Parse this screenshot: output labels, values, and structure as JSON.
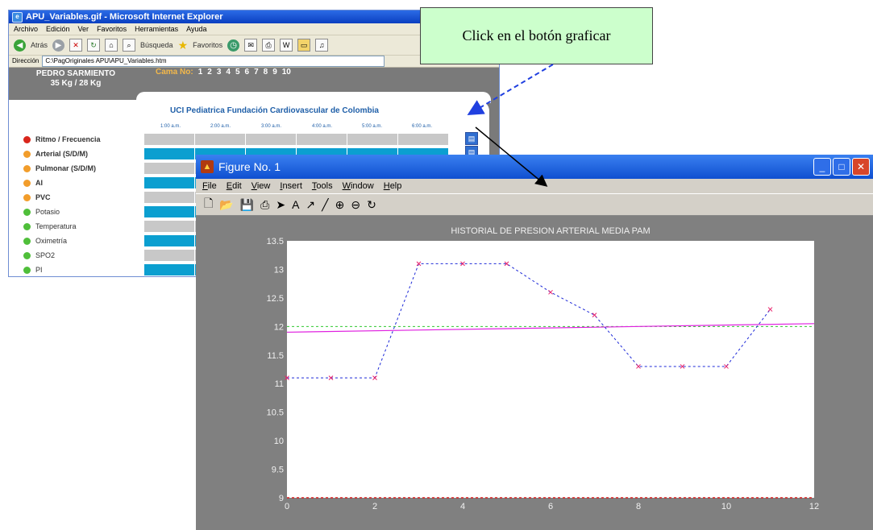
{
  "ie": {
    "title": "APU_Variables.gif - Microsoft Internet Explorer",
    "menu": [
      "Archivo",
      "Edición",
      "Ver",
      "Favoritos",
      "Herramientas",
      "Ayuda"
    ],
    "toolbar": {
      "back": "Atrás",
      "search": "Búsqueda",
      "favorites": "Favoritos"
    },
    "address_label": "Dirección",
    "address_value": "C:\\PagOriginales APU\\APU_Variables.htm"
  },
  "patient": {
    "name": "PEDRO SARMIENTO",
    "weight": "35 Kg / 28 Kg"
  },
  "cama": {
    "label": "Cama No:",
    "numbers": [
      "1",
      "2",
      "3",
      "4",
      "5",
      "6",
      "7",
      "8",
      "9",
      "10"
    ]
  },
  "uci_title": "UCI Pediatrica Fundación Cardiovascular de Colombia",
  "times": [
    "1:00 a.m.",
    "2:00 a.m.",
    "3:00 a.m.",
    "4:00 a.m.",
    "5:00 a.m.",
    "6:00 a.m."
  ],
  "variables": [
    {
      "label": "Ritmo / Frecuencia",
      "color": "#d9261c",
      "bold": true
    },
    {
      "label": "Arterial (S/D/M)",
      "color": "#f29d2b",
      "bold": true
    },
    {
      "label": "Pulmonar (S/D/M)",
      "color": "#f29d2b",
      "bold": true
    },
    {
      "label": "AI",
      "color": "#f29d2b",
      "bold": true
    },
    {
      "label": "PVC",
      "color": "#f29d2b",
      "bold": true
    },
    {
      "label": "Potasio",
      "color": "#4fbf3a",
      "bold": false
    },
    {
      "label": "Temperatura",
      "color": "#4fbf3a",
      "bold": false
    },
    {
      "label": "Oximetría",
      "color": "#4fbf3a",
      "bold": false
    },
    {
      "label": "SPO2",
      "color": "#4fbf3a",
      "bold": false
    },
    {
      "label": "PI",
      "color": "#4fbf3a",
      "bold": false
    }
  ],
  "callout": {
    "text": "Click en el botón graficar"
  },
  "figure": {
    "title": "Figure No. 1",
    "menu": [
      "File",
      "Edit",
      "View",
      "Insert",
      "Tools",
      "Window",
      "Help"
    ]
  },
  "chart_data": {
    "type": "line",
    "title": "HISTORIAL DE PRESION ARTERIAL MEDIA PAM",
    "xlabel": "",
    "ylabel": "",
    "xlim": [
      0,
      12
    ],
    "ylim": [
      9,
      13.5
    ],
    "xticks": [
      0,
      2,
      4,
      6,
      8,
      10,
      12
    ],
    "yticks": [
      9,
      9.5,
      10,
      10.5,
      11,
      11.5,
      12,
      12.5,
      13,
      13.5
    ],
    "series": [
      {
        "style": "dashed-blue-with-red-x-markers",
        "x": [
          0,
          1,
          2,
          3,
          4,
          5,
          6,
          7,
          8,
          9,
          10,
          11
        ],
        "y": [
          11.1,
          11.1,
          11.1,
          13.1,
          13.1,
          13.1,
          12.6,
          12.2,
          11.3,
          11.3,
          11.3,
          12.3
        ]
      },
      {
        "style": "solid-magenta",
        "x": [
          0,
          12
        ],
        "y": [
          11.9,
          12.05
        ]
      },
      {
        "style": "dashed-green",
        "x": [
          0,
          12
        ],
        "y": [
          12,
          12
        ]
      },
      {
        "style": "dashed-red",
        "x": [
          0,
          12
        ],
        "y": [
          9,
          9
        ]
      }
    ],
    "colors": {
      "series": "#1e2ad8",
      "markers": "#e8206a",
      "trend": "#e020e0",
      "reference": "#2ec82e",
      "baseline": "#d81e1e"
    }
  }
}
